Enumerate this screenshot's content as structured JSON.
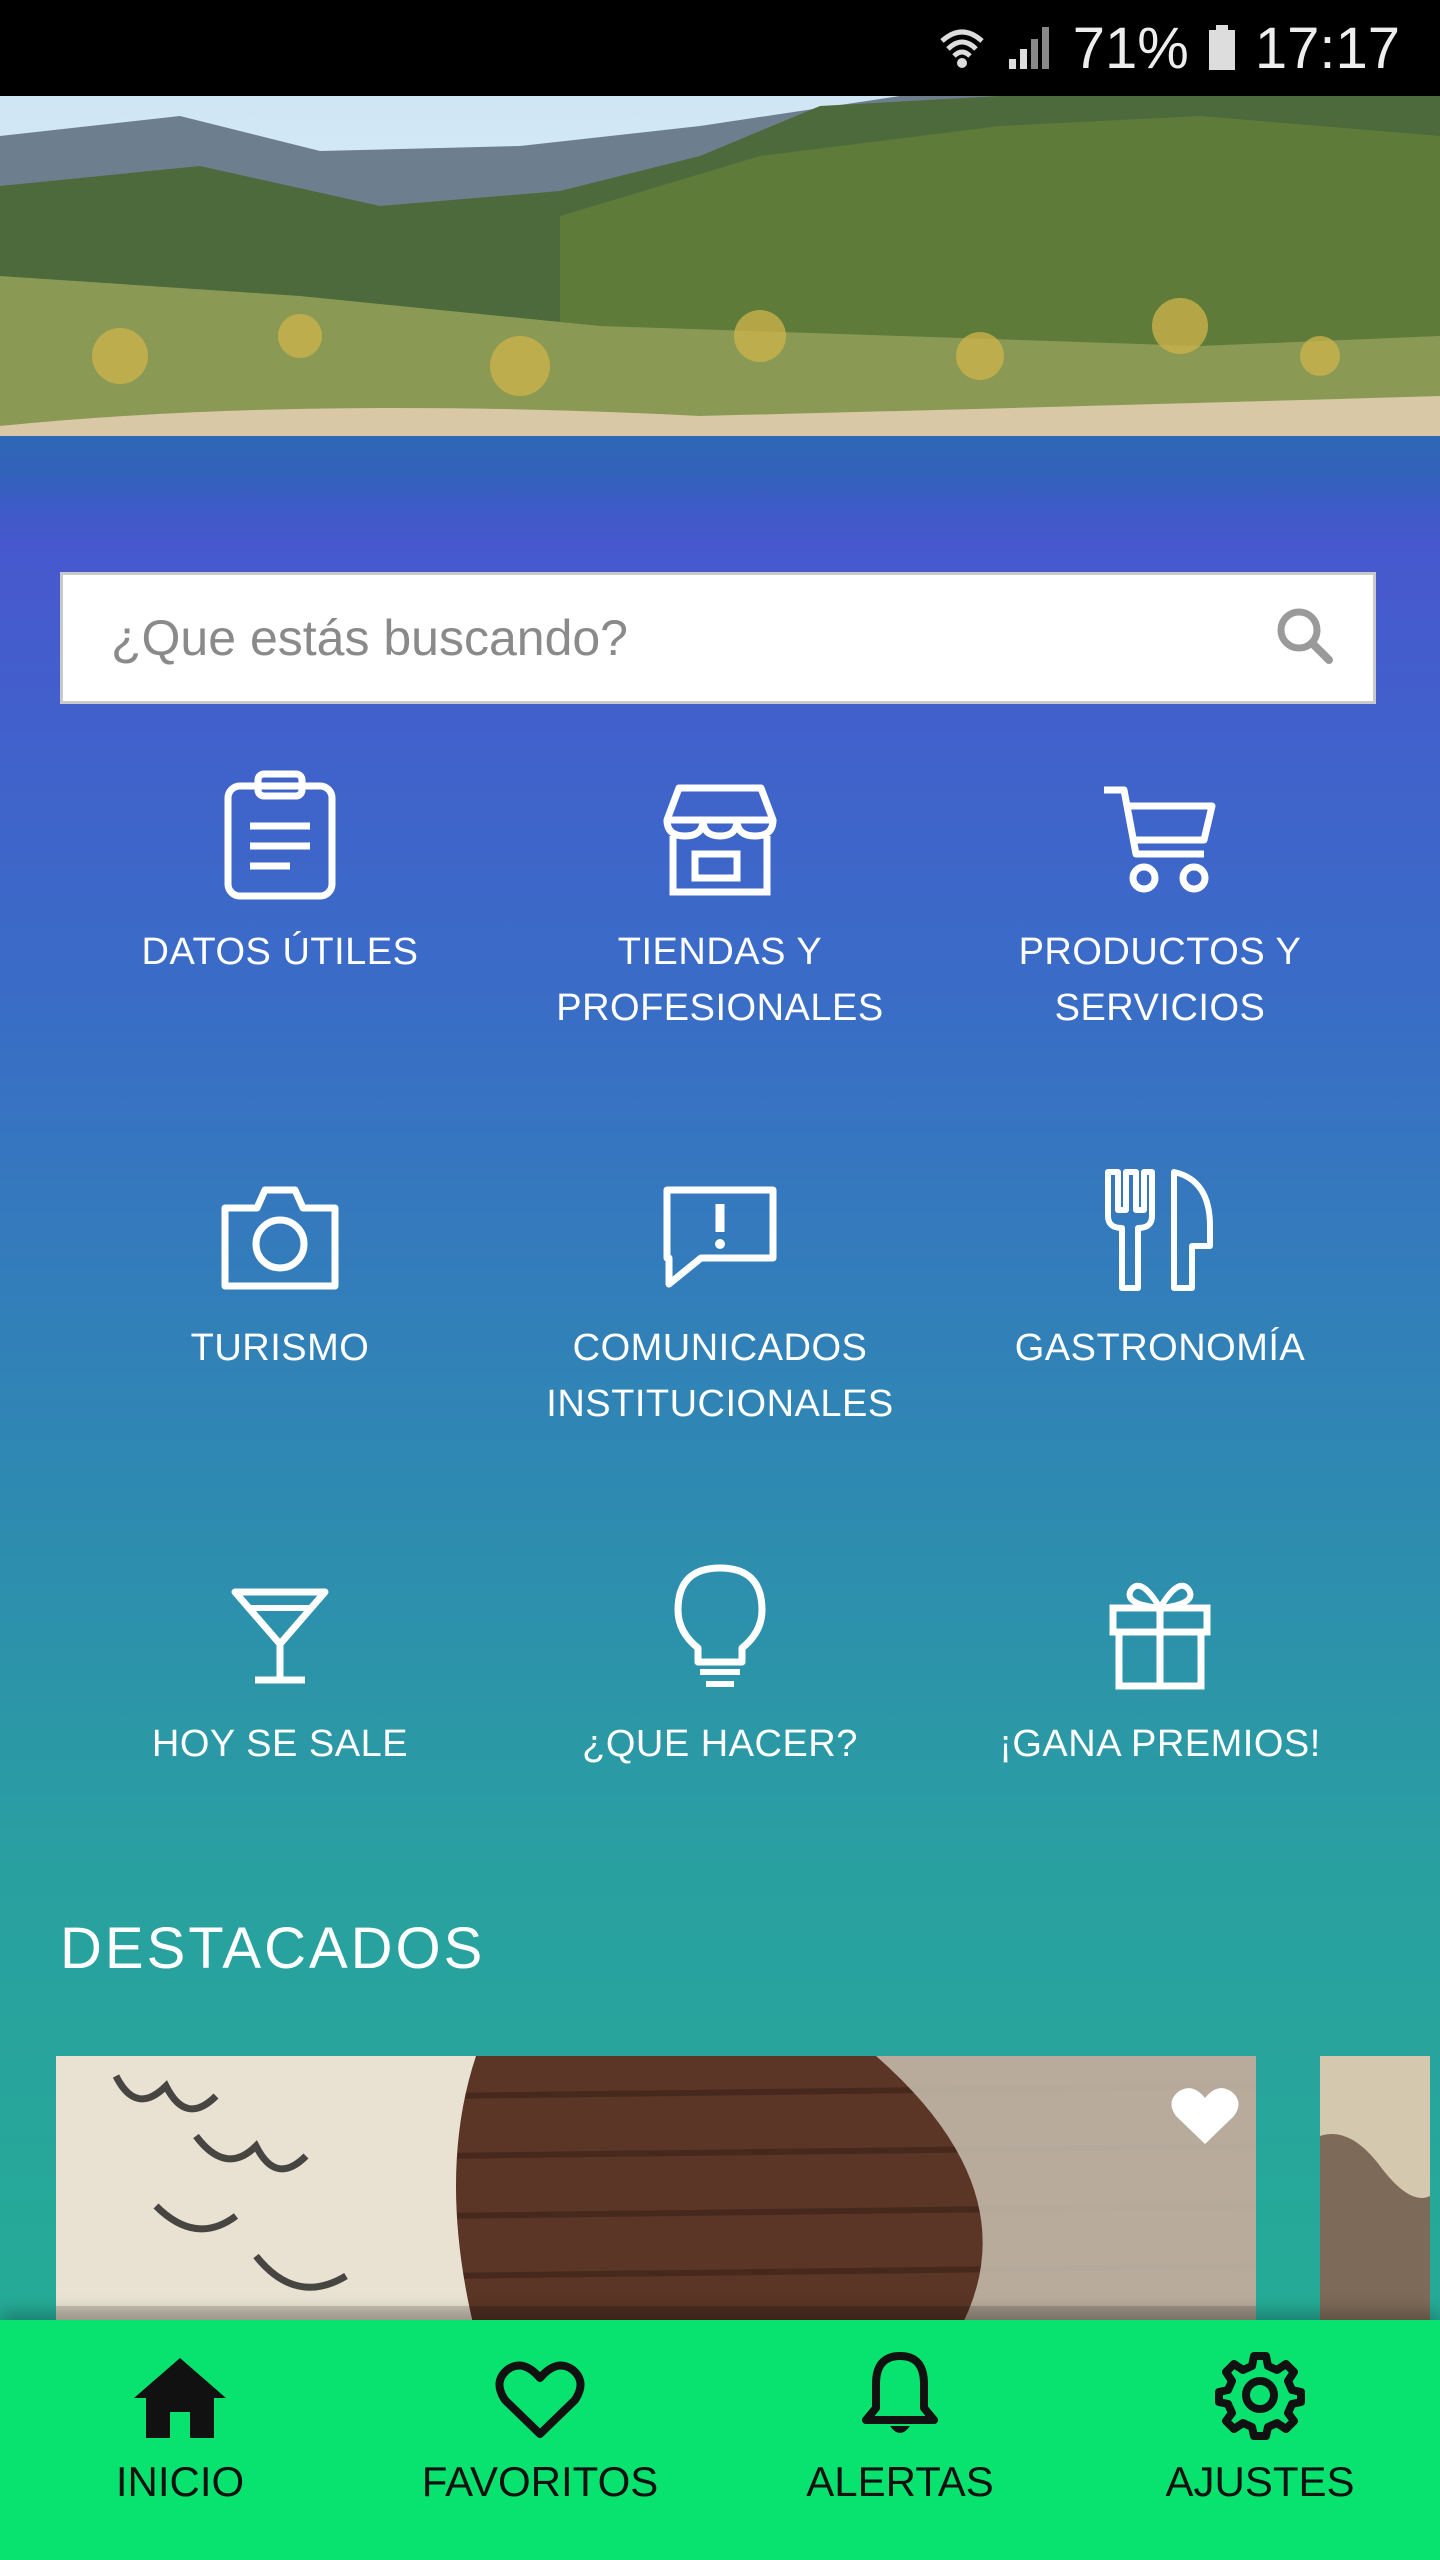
{
  "status_bar": {
    "battery": "71%",
    "time": "17:17"
  },
  "search": {
    "placeholder": "¿Que estás buscando?"
  },
  "categories": [
    {
      "label_1": "DATOS ÚTILES",
      "label_2": "",
      "icon": "clipboard-icon"
    },
    {
      "label_1": "TIENDAS Y",
      "label_2": "PROFESIONALES",
      "icon": "store-icon"
    },
    {
      "label_1": "PRODUCTOS Y",
      "label_2": "SERVICIOS",
      "icon": "cart-icon"
    },
    {
      "label_1": "TURISMO",
      "label_2": "",
      "icon": "camera-icon"
    },
    {
      "label_1": "COMUNICADOS",
      "label_2": "INSTITUCIONALES",
      "icon": "alert-message-icon"
    },
    {
      "label_1": "GASTRONOMÍA",
      "label_2": "",
      "icon": "fork-knife-icon"
    },
    {
      "label_1": "HOY SE SALE",
      "label_2": "",
      "icon": "cocktail-icon"
    },
    {
      "label_1": "¿QUE HACER?",
      "label_2": "",
      "icon": "lightbulb-icon"
    },
    {
      "label_1": "¡GANA PREMIOS!",
      "label_2": "",
      "icon": "gift-icon"
    }
  ],
  "featured": {
    "title": "DESTACADOS"
  },
  "nav": {
    "items": [
      {
        "label": "INICIO",
        "icon": "home-icon"
      },
      {
        "label": "FAVORITOS",
        "icon": "heart-icon"
      },
      {
        "label": "ALERTAS",
        "icon": "bell-icon"
      },
      {
        "label": "AJUSTES",
        "icon": "gear-icon"
      }
    ]
  },
  "colors": {
    "nav_bg": "#08e36f",
    "gradient_top": "#4758cf",
    "gradient_bottom": "#25ab97"
  }
}
